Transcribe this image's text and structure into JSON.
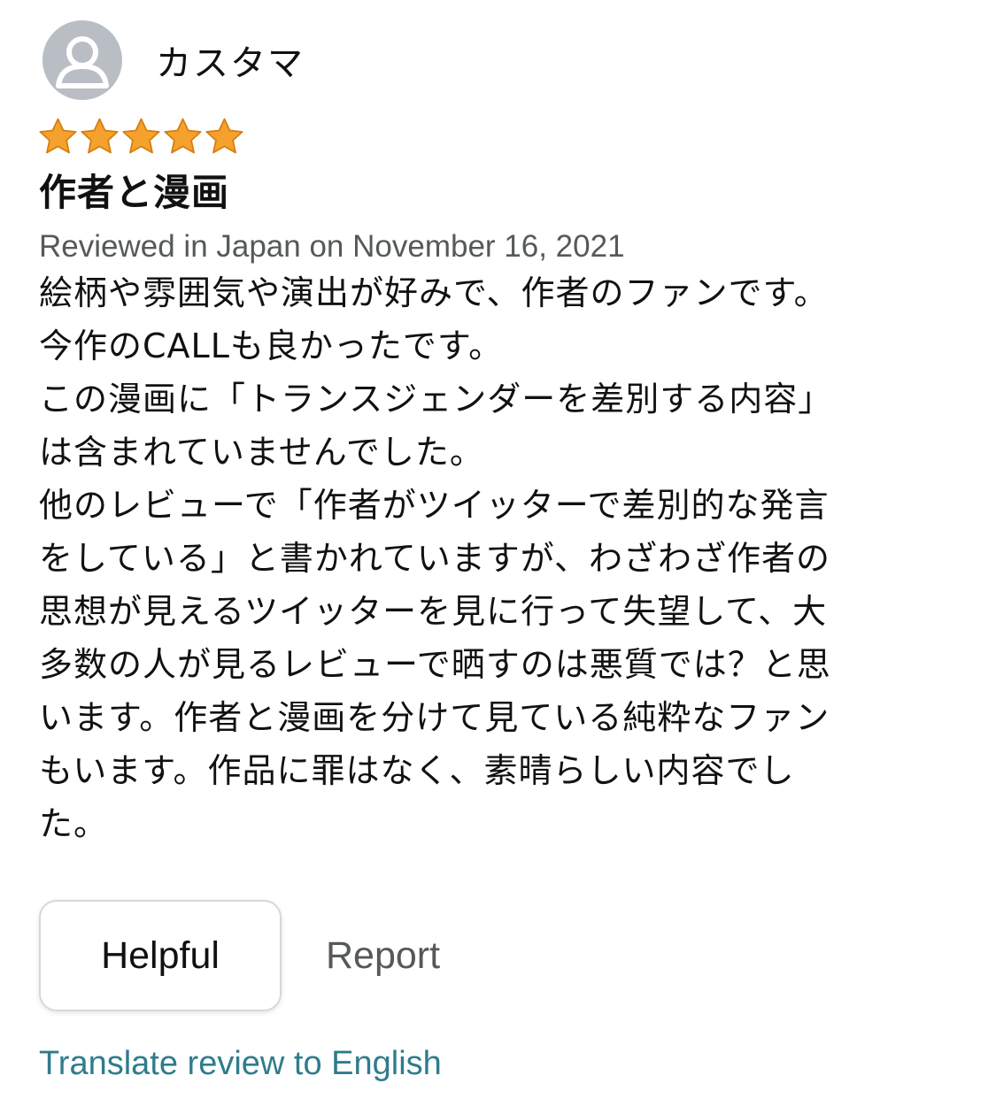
{
  "review": {
    "author": "カスタマ",
    "rating": 5,
    "rating_max": 5,
    "title": "作者と漫画",
    "date": "Reviewed in Japan on November 16, 2021",
    "body_lines": [
      "絵柄や雰囲気や演出が好みで、作者のファンです。",
      "今作のCALLも良かったです。",
      "この漫画に「トランスジェンダーを差別する内容」",
      "は含まれていませんでした。",
      "他のレビューで「作者がツイッターで差別的な発言",
      "をしている」と書かれていますが、わざわざ作者の",
      "思想が見えるツイッターを見に行って失望して、大",
      "多数の人が見るレビューで晒すのは悪質では？と思",
      "います。作者と漫画を分けて見ている純粋なファン",
      "もいます。作品に罪はなく、素晴らしい内容でし",
      "た。"
    ]
  },
  "actions": {
    "helpful_label": "Helpful",
    "report_label": "Report",
    "translate_label": "Translate review to English"
  },
  "icons": {
    "avatar": "user-avatar-icon",
    "star": "star-icon"
  },
  "colors": {
    "star_fill": "#f4a12e",
    "star_stroke": "#d47e0f",
    "avatar_bg": "#b8bec3",
    "date_text": "#565959",
    "link_text": "#2f7c8c"
  }
}
